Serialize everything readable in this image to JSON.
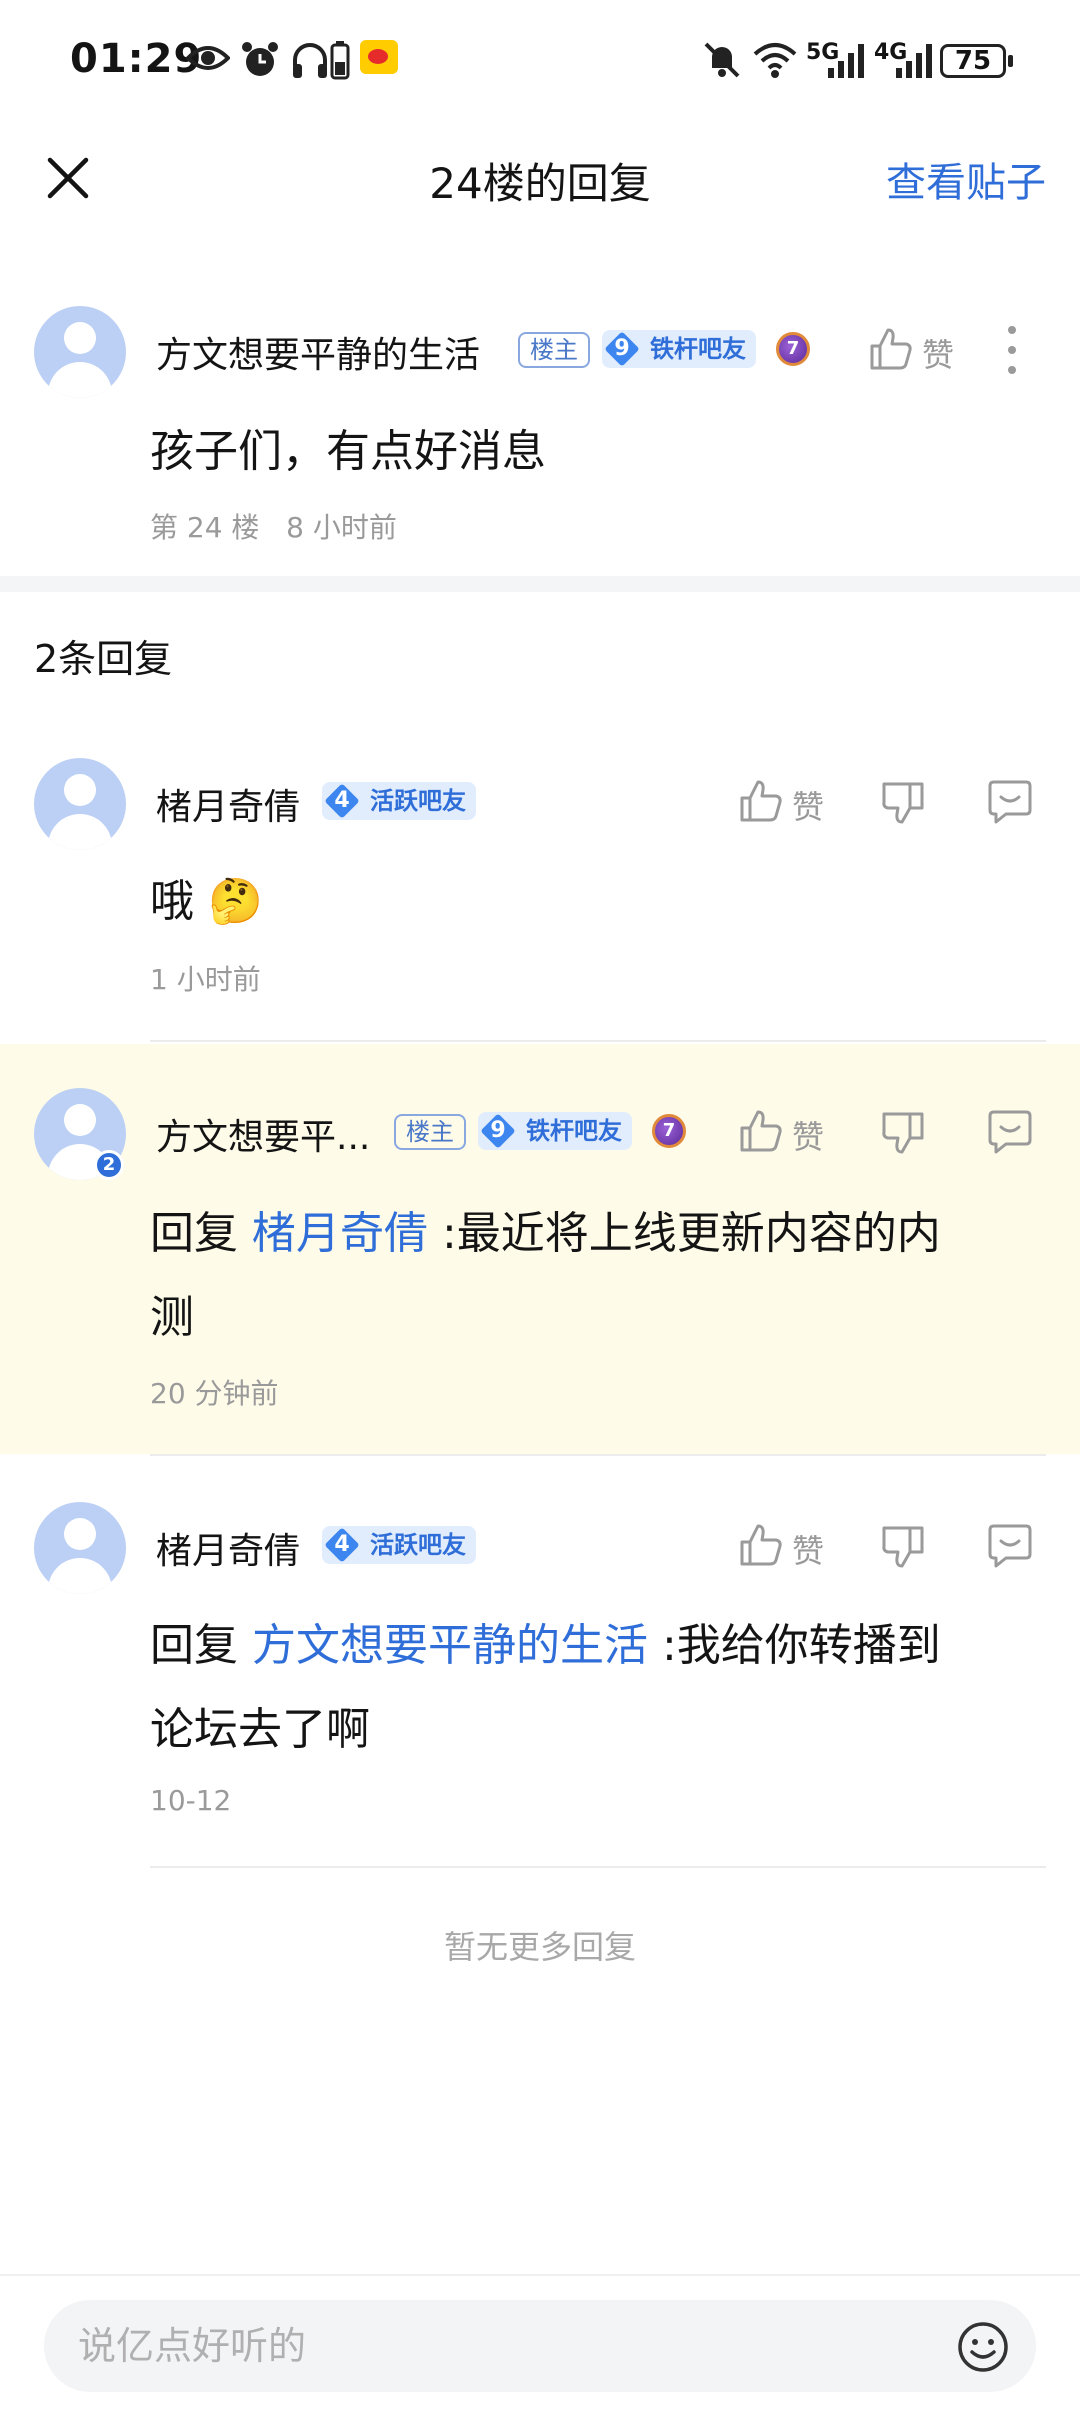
{
  "status_bar": {
    "time": "01:29",
    "signal_5g": "5G",
    "signal_4g": "4G",
    "battery": "75",
    "icons": [
      "eye-icon",
      "alarm-icon",
      "headphones-icon",
      "battery-small-icon",
      "weibo-icon",
      "mute-icon",
      "wifi-icon",
      "signal-icon"
    ]
  },
  "nav": {
    "title": "24楼的回复",
    "view_post": "查看贴子",
    "close_icon": "close-icon"
  },
  "main_post": {
    "username": "方文想要平静的生活",
    "owner_tag": "楼主",
    "level": "9",
    "level_title": "铁杆吧友",
    "medal_number": "7",
    "like_label": "赞",
    "content": "孩子们，有点好消息",
    "floor": "第 24 楼",
    "time": "8 小时前"
  },
  "replies_header": "2条回复",
  "replies": [
    {
      "username": "楮月奇倩",
      "level": "4",
      "level_title": "活跃吧友",
      "like_label": "赞",
      "content": "哦",
      "emoji": "🤔",
      "time": "1 小时前"
    },
    {
      "username": "方文想要平...",
      "owner_tag": "楼主",
      "level": "9",
      "level_title": "铁杆吧友",
      "medal_number": "7",
      "avatar_badge": "2",
      "like_label": "赞",
      "reply_prefix": "回复 ",
      "reply_to": "楮月奇倩",
      "content_line1": " :最近将上线更新内容的内",
      "content_line2": "测",
      "time": "20 分钟前"
    },
    {
      "username": "楮月奇倩",
      "level": "4",
      "level_title": "活跃吧友",
      "like_label": "赞",
      "reply_prefix": "回复 ",
      "reply_to": "方文想要平静的生活",
      "content_line1": " :我给你转播到",
      "content_line2": "论坛去了啊",
      "time": "10-12"
    }
  ],
  "no_more": "暂无更多回复",
  "composer": {
    "placeholder": "说亿点好听的"
  },
  "colors": {
    "accent": "#2f6ed8",
    "highlight": "#fefbe9",
    "muted": "#9a9a9a"
  }
}
